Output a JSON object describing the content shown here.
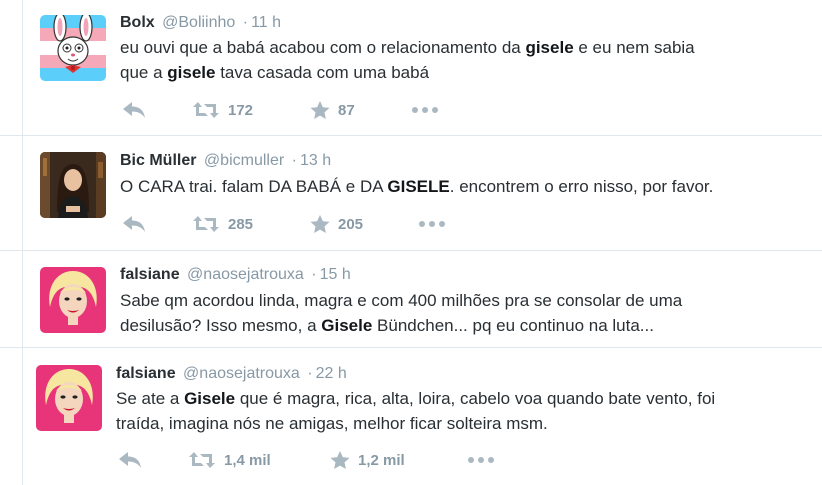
{
  "tweets": [
    {
      "name": "Bolx",
      "handle": "@Boliinho",
      "separator": "·",
      "time": "11 h",
      "avatar_icon": "rabbit-cartoon-avatar",
      "avatar_colors": {
        "stripe_blue": "#5bcefa",
        "stripe_pink": "#f5a9b8",
        "stripe_white": "#ffffff"
      },
      "line1": {
        "a": "eu ouvi que a babá acabou com o relacionamento da ",
        "b": "gisele",
        "c": " e eu nem sabia"
      },
      "line2": {
        "a": "que a ",
        "b": "gisele",
        "c": " tava casada com uma babá"
      },
      "retweets": "172",
      "likes": "87"
    },
    {
      "name": "Bic Müller",
      "handle": "@bicmuller",
      "separator": "·",
      "time": "13 h",
      "avatar_icon": "woman-photo-avatar",
      "line1": {
        "a": "O CARA trai. falam DA BABÁ e DA ",
        "b": "GISELE",
        "c": ". encontrem o erro nisso, por favor."
      },
      "retweets": "285",
      "likes": "205"
    },
    {
      "name": "falsiane",
      "handle": "@naosejatrouxa",
      "separator": "·",
      "time": "15 h",
      "avatar_icon": "marilyn-portrait-avatar",
      "line1": {
        "a": "Sabe qm acordou linda, magra e com 400 milhões pra se consolar de uma"
      },
      "line2": {
        "a": "desilusão? Isso mesmo, a ",
        "b": "Gisele",
        "c": " Bündchen... pq eu continuo na luta..."
      }
    },
    {
      "name": "falsiane",
      "handle": "@naosejatrouxa",
      "separator": "·",
      "time": "22 h",
      "avatar_icon": "marilyn-portrait-avatar",
      "line1": {
        "a": "Se ate a ",
        "b": "Gisele",
        "c": " que é magra, rica, alta, loira, cabelo voa quando bate vento, foi"
      },
      "line2": {
        "a": "traída, imagina nós ne amigas, melhor ficar solteira msm."
      },
      "retweets": "1,4 mil",
      "likes": "1,2 mil"
    }
  ],
  "icons": {
    "reply": "reply-arrow-icon",
    "retweet": "retweet-icon",
    "like": "star-icon",
    "more": "more-dots-icon"
  },
  "colors": {
    "icon_gray": "#aab8c2",
    "count_gray": "#8899a6",
    "text": "#292f33"
  }
}
